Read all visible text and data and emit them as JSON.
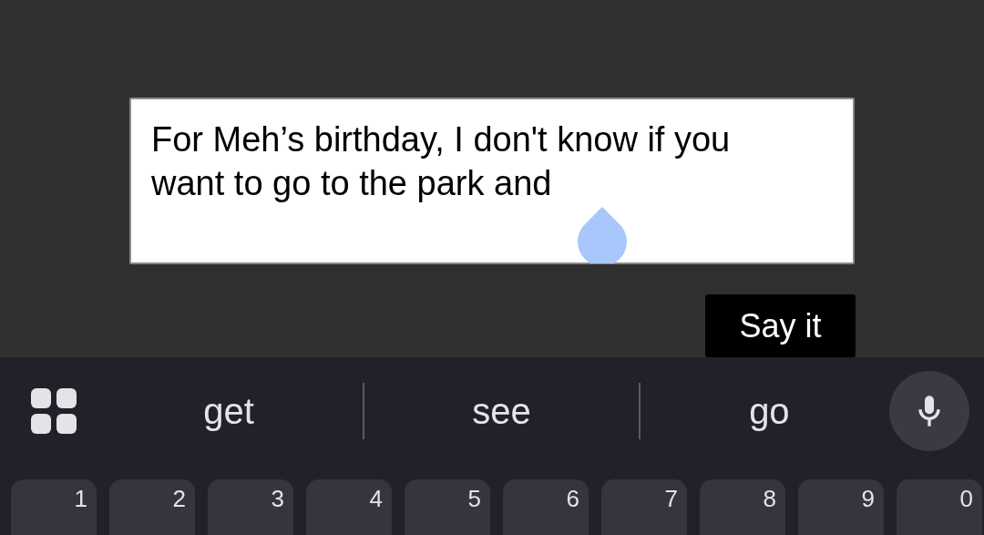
{
  "message_field": {
    "value": "For Meh’s birthday, I don't know if you want to go to the park and"
  },
  "say_button": {
    "label": "Say it"
  },
  "suggestions": [
    "get",
    "see",
    "go"
  ],
  "number_keys": [
    "1",
    "2",
    "3",
    "4",
    "5",
    "6",
    "7",
    "8",
    "9",
    "0"
  ]
}
